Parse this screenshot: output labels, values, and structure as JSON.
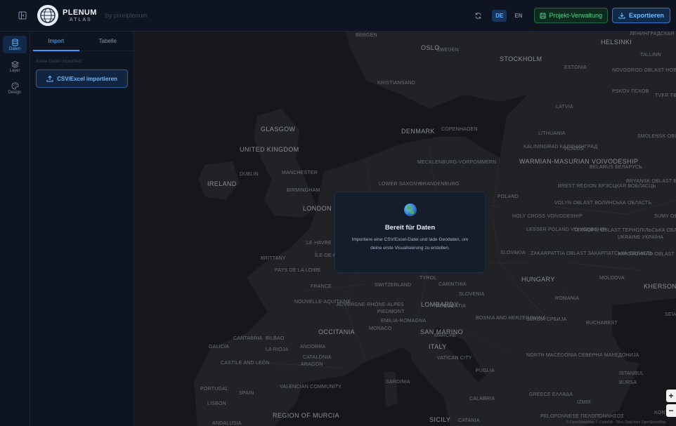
{
  "header": {
    "brand_name": "PLENUM",
    "brand_sub": "ATLAS",
    "byline": "by pixelplenum",
    "lang_de": "DE",
    "lang_en": "EN",
    "project_button": "Projekt-Verwaltung",
    "export_button": "Exportieren"
  },
  "rail": {
    "items": [
      {
        "label": "Daten",
        "icon": "database-icon",
        "active": true
      },
      {
        "label": "Layer",
        "icon": "layers-icon",
        "active": false
      },
      {
        "label": "Design",
        "icon": "palette-icon",
        "active": false
      }
    ]
  },
  "panel": {
    "tabs": [
      "Import",
      "Tabelle"
    ],
    "empty_note": "Keine Daten importiert",
    "import_button": "CSV/Excel importieren"
  },
  "map": {
    "labels": [
      {
        "text": "BERGEN"
      },
      {
        "text": "OSLO"
      },
      {
        "text": "SWEDEN"
      },
      {
        "text": "STOCKHOLM"
      },
      {
        "text": "HELSINKI"
      },
      {
        "text": "ЛЕНИНГРАДСКАЯ ОБЛАСТЬ"
      },
      {
        "text": "TALLINN"
      },
      {
        "text": "ESTONIA"
      },
      {
        "text": "NOVGOROD OBLAST НОВГОРОДСКАЯ ОБЛАСТЬ"
      },
      {
        "text": "PSKOV ПСКОВ"
      },
      {
        "text": "TVER ТВЕРСКАЯ"
      },
      {
        "text": "KRISTIANSAND"
      },
      {
        "text": "LATVIA"
      },
      {
        "text": "GLASGOW"
      },
      {
        "text": "DENMARK"
      },
      {
        "text": "COPENHAGEN"
      },
      {
        "text": "LITHUANIA"
      },
      {
        "text": "SMOLENSK OBLAST СМОЛЕНСКАЯ ОБЛАСТЬ"
      },
      {
        "text": "UNITED KINGDOM"
      },
      {
        "text": "KALININGRAD КАЛИНИНГРАД"
      },
      {
        "text": "VILNIUS"
      },
      {
        "text": "MECKLENBURG-VORPOMMERN"
      },
      {
        "text": "WARMIAN-MASURIAN VOIVODESHIP"
      },
      {
        "text": "DUBLIN"
      },
      {
        "text": "MANCHESTER"
      },
      {
        "text": "BELARUS БЕЛАРУСЬ"
      },
      {
        "text": "IRELAND"
      },
      {
        "text": "LOWER SAXONY"
      },
      {
        "text": "BRANDENBURG"
      },
      {
        "text": "BRYANSK OBLAST БРЯНСКАЯ ОБЛАСТЬ"
      },
      {
        "text": "BIRMINGHAM"
      },
      {
        "text": "BREST REGION БРЭСЦКАЯ ВОБЛАСЦЬ"
      },
      {
        "text": "POLAND"
      },
      {
        "text": "LONDON"
      },
      {
        "text": "VOLYN OBLAST ВОЛИНСЬКА ОБЛАСТЬ"
      },
      {
        "text": "HOLY CROSS VOIVODESHIP"
      },
      {
        "text": "SUMY OBLAST СУМСЬКА ОБЛАСТЬ"
      },
      {
        "text": "LESSER POLAND VOIVODESHIP"
      },
      {
        "text": "TERNOPIL OBLAST ТЕРНОПІЛЬСЬКА ОБЛАСТЬ"
      },
      {
        "text": "UKRAINE УКРАЇНА"
      },
      {
        "text": "LE HAVRE"
      },
      {
        "text": "ÎLE-DE-FR"
      },
      {
        "text": "SLOVAKIA"
      },
      {
        "text": "ZAKARPATTIA OBLAST ЗАКАРПАТСЬКА ОБЛАСТЬ"
      },
      {
        "text": "KIROVOHRAD OBLAST КІРОВОГРАДСЬКА ОБЛАСТЬ"
      },
      {
        "text": "BRITTANY"
      },
      {
        "text": "PAYS DE LA LOIRE"
      },
      {
        "text": "TYROL"
      },
      {
        "text": "HUNGARY"
      },
      {
        "text": "MOLDOVA"
      },
      {
        "text": "FRANCE"
      },
      {
        "text": "SWITZERLAND"
      },
      {
        "text": "CARINTHIA"
      },
      {
        "text": "KHERSON OBLAST ХЕРСОНСЬКА ОБЛАСТЬ"
      },
      {
        "text": "SLOVENIA"
      },
      {
        "text": "ROMANIA"
      },
      {
        "text": "NOUVELLE-AQUITAINE"
      },
      {
        "text": "AUVERGNE-RHÔNE-ALPES"
      },
      {
        "text": "LOMBARDY"
      },
      {
        "text": "VENICE"
      },
      {
        "text": "CROATIA"
      },
      {
        "text": "PIEDMONT"
      },
      {
        "text": "SEVASTOPOL"
      },
      {
        "text": "EMILIA-ROMAGNA"
      },
      {
        "text": "BOSNIA AND HERZEGOVINA"
      },
      {
        "text": "SERBIA СРБИЈА"
      },
      {
        "text": "BUCHAREST"
      },
      {
        "text": "MONACO"
      },
      {
        "text": "SAN MARINO"
      },
      {
        "text": "OCCITANIA"
      },
      {
        "text": "MARCHE"
      },
      {
        "text": "CANTABRIA"
      },
      {
        "text": "BILBAO"
      },
      {
        "text": "GALICIA"
      },
      {
        "text": "ANDORRA"
      },
      {
        "text": "ITALY"
      },
      {
        "text": "LA RIOJA"
      },
      {
        "text": "CATALONIA"
      },
      {
        "text": "VATICAN CITY"
      },
      {
        "text": "NORTH MACEDONIA СЕВЕРНА МАКЕДОНИЈА"
      },
      {
        "text": "CASTILE AND LEÓN"
      },
      {
        "text": "ARAGON"
      },
      {
        "text": "PUGLIA"
      },
      {
        "text": "ISTANBUL"
      },
      {
        "text": "BURSA"
      },
      {
        "text": "SARDINIA"
      },
      {
        "text": "PORTUGAL"
      },
      {
        "text": "SPAIN"
      },
      {
        "text": "VALENCIAN COMMUNITY"
      },
      {
        "text": "CALABRIA"
      },
      {
        "text": "GREECE ΕΛΛΆΔΑ"
      },
      {
        "text": "IZMIR"
      },
      {
        "text": "LISBON"
      },
      {
        "text": "REGION OF MURCIA"
      },
      {
        "text": "ANDALUSIA"
      },
      {
        "text": "SICILY"
      },
      {
        "text": "CATANIA"
      },
      {
        "text": "PELOPONNESE ΠΕΛΟΠΌΝΝΗΣΟΣ"
      },
      {
        "text": "KONYA"
      }
    ],
    "attribution": "© OpenStreetMap © CartoDB · Tiles, Data from OpenStreetMap"
  },
  "card": {
    "title": "Bereit für Daten",
    "text": "Importiere eine CSV/Excel-Datei und lade Geodaten, um deine erste Visualisierung zu erstellen."
  },
  "zoom": {
    "in": "+",
    "out": "−"
  },
  "colors": {
    "accent": "#3d98ff",
    "green": "#4ed48c",
    "map_land": "#202226",
    "map_sea": "#15171b"
  }
}
